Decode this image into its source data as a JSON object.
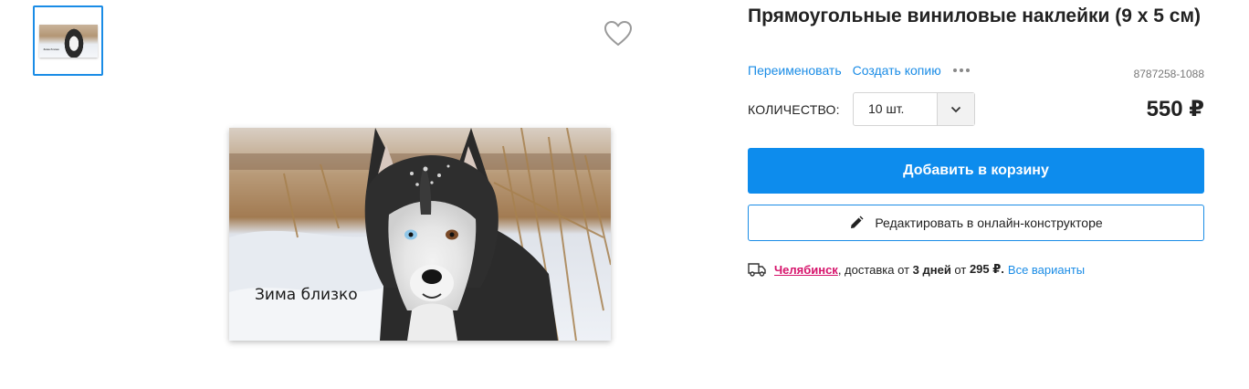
{
  "gallery": {
    "thumbnail_caption": "Зима близко",
    "sticker_caption": "Зима близко"
  },
  "product": {
    "title": "Прямоугольные виниловые наклейки (9 х 5 см)",
    "rename_label": "Переименовать",
    "copy_label": "Создать копию",
    "more_icon": "more-dots-icon",
    "sku": "8787258-1088",
    "quantity_label": "КОЛИЧЕСТВО:",
    "quantity_value": "10 шт.",
    "price": "550 ₽"
  },
  "buttons": {
    "add_to_cart": "Добавить в корзину",
    "edit_online": "Редактировать в онлайн-конструкторе"
  },
  "delivery": {
    "city": "Челябинск",
    "text_before_days": ", доставка от ",
    "days": "3 дней",
    "text_before_price": " от ",
    "price": "295 ₽.",
    "all_options": "Все варианты"
  },
  "colors": {
    "accent": "#0d8ced",
    "link": "#1a8ce6",
    "city": "#d6136b"
  }
}
